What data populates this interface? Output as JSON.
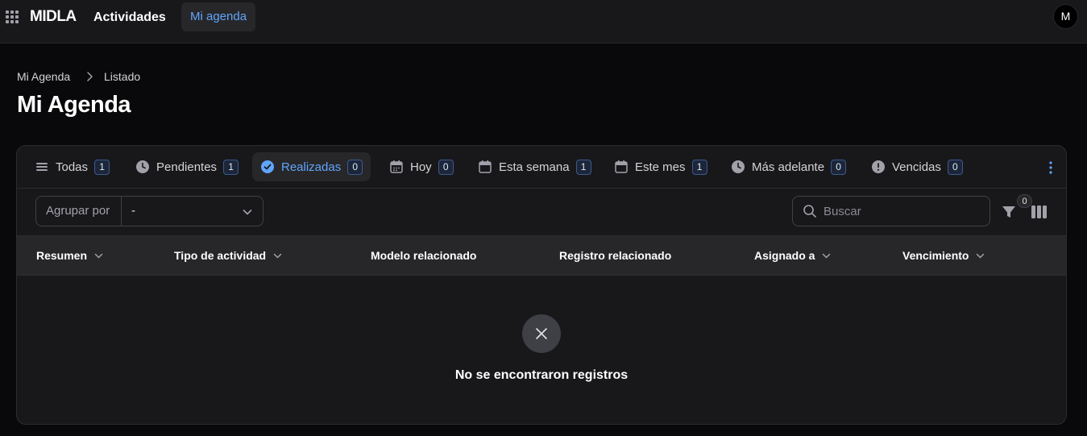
{
  "topbar": {
    "brand": "MIDLA",
    "nav_link": "Actividades",
    "nav_active": "Mi agenda",
    "avatar_initial": "M"
  },
  "breadcrumb": {
    "items": [
      "Mi Agenda",
      "Listado"
    ]
  },
  "page_title": "Mi Agenda",
  "tabs": [
    {
      "label": "Todas",
      "count": "1",
      "icon": "list-icon"
    },
    {
      "label": "Pendientes",
      "count": "1",
      "icon": "clock-icon"
    },
    {
      "label": "Realizadas",
      "count": "0",
      "icon": "check-circle-icon",
      "active": true
    },
    {
      "label": "Hoy",
      "count": "0",
      "icon": "calendar-icon"
    },
    {
      "label": "Esta semana",
      "count": "1",
      "icon": "calendar-icon"
    },
    {
      "label": "Este mes",
      "count": "1",
      "icon": "calendar-icon"
    },
    {
      "label": "Más adelante",
      "count": "0",
      "icon": "clock-icon"
    },
    {
      "label": "Vencidas",
      "count": "0",
      "icon": "alert-circle-icon"
    }
  ],
  "toolbar": {
    "group_by_label": "Agrupar por",
    "group_by_value": "-",
    "search_placeholder": "Buscar",
    "filter_count": "0"
  },
  "table": {
    "columns": [
      "Resumen",
      "Tipo de actividad",
      "Modelo relacionado",
      "Registro relacionado",
      "Asignado a",
      "Vencimiento"
    ],
    "empty_message": "No se encontraron registros"
  },
  "colors": {
    "accent": "#60a5fa",
    "background": "#09090b",
    "surface": "#18181b"
  }
}
